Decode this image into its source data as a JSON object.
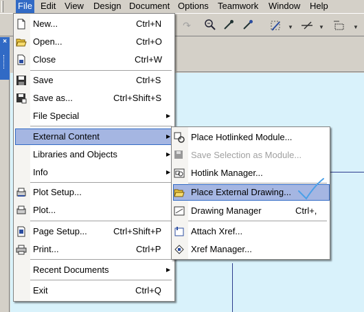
{
  "menubar": {
    "items": [
      "File",
      "Edit",
      "View",
      "Design",
      "Document",
      "Options",
      "Teamwork",
      "Window",
      "Help"
    ]
  },
  "toolbar": {
    "icons": [
      "redo-icon",
      "zoom-icon",
      "eyedropper-icon",
      "inject-icon",
      "magic-wand-icon",
      "trace-icon",
      "elevation-icon"
    ]
  },
  "file_menu": {
    "items": [
      {
        "label": "New...",
        "shortcut": "Ctrl+N",
        "icon": "new-document-icon"
      },
      {
        "label": "Open...",
        "shortcut": "Ctrl+O",
        "icon": "open-folder-icon"
      },
      {
        "label": "Close",
        "shortcut": "Ctrl+W",
        "icon": "close-document-icon"
      },
      {
        "label": "Save",
        "shortcut": "Ctrl+S",
        "icon": "save-icon"
      },
      {
        "label": "Save as...",
        "shortcut": "Ctrl+Shift+S",
        "icon": "save-as-icon"
      },
      {
        "label": "File Special",
        "shortcut": "",
        "submenu": true
      },
      {
        "label": "External Content",
        "shortcut": "",
        "submenu": true,
        "highlighted": true
      },
      {
        "label": "Libraries and Objects",
        "shortcut": "",
        "submenu": true
      },
      {
        "label": "Info",
        "shortcut": "",
        "submenu": true
      },
      {
        "label": "Plot Setup...",
        "shortcut": "",
        "icon": "plot-setup-icon"
      },
      {
        "label": "Plot...",
        "shortcut": "",
        "icon": "plot-icon"
      },
      {
        "label": "Page Setup...",
        "shortcut": "Ctrl+Shift+P",
        "icon": "page-setup-icon"
      },
      {
        "label": "Print...",
        "shortcut": "Ctrl+P",
        "icon": "print-icon"
      },
      {
        "label": "Recent Documents",
        "shortcut": "",
        "submenu": true
      },
      {
        "label": "Exit",
        "shortcut": "Ctrl+Q"
      }
    ]
  },
  "external_content_menu": {
    "items": [
      {
        "label": "Place Hotlinked Module...",
        "shortcut": "",
        "icon": "hotlink-module-icon"
      },
      {
        "label": "Save Selection as Module...",
        "shortcut": "",
        "icon": "save-module-icon",
        "disabled": true
      },
      {
        "label": "Hotlink Manager...",
        "shortcut": "",
        "icon": "hotlink-manager-icon"
      },
      {
        "label": "Place External Drawing...",
        "shortcut": "",
        "icon": "open-folder-icon",
        "highlighted": true
      },
      {
        "label": "Drawing Manager",
        "shortcut": "Ctrl+,",
        "icon": "drawing-manager-icon"
      },
      {
        "label": "Attach Xref...",
        "shortcut": "",
        "icon": "attach-xref-icon"
      },
      {
        "label": "Xref Manager...",
        "shortcut": "",
        "icon": "xref-manager-icon"
      }
    ]
  },
  "colors": {
    "menu_highlight": "#a5b6e2",
    "menubar_active": "#316ac5",
    "canvas": "#d9f2fb",
    "check_mark": "#4aa0e8"
  }
}
